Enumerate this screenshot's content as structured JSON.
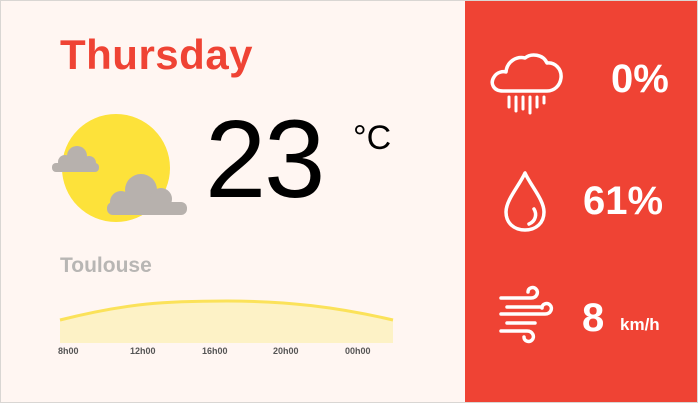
{
  "forecast": {
    "day": "Thursday",
    "temperature": "23",
    "unit": "°C",
    "city": "Toulouse",
    "condition_icon": "sun-with-clouds-icon"
  },
  "hourly_chart": {
    "type": "area",
    "ticks": [
      "8h00",
      "12h00",
      "16h00",
      "20h00",
      "00h00"
    ],
    "colors": {
      "line": "#fbe25a",
      "fill": "#fdf2c6"
    }
  },
  "metrics": {
    "rain": {
      "icon": "rain-cloud-icon",
      "value": "0%"
    },
    "humidity": {
      "icon": "water-drop-icon",
      "value": "61%"
    },
    "wind": {
      "icon": "wind-icon",
      "value": "8",
      "unit": "km/h"
    }
  },
  "colors": {
    "accent": "#ef4334",
    "background": "#fff6f2",
    "sun": "#fde23a",
    "cloud": "#b7b1ad"
  }
}
